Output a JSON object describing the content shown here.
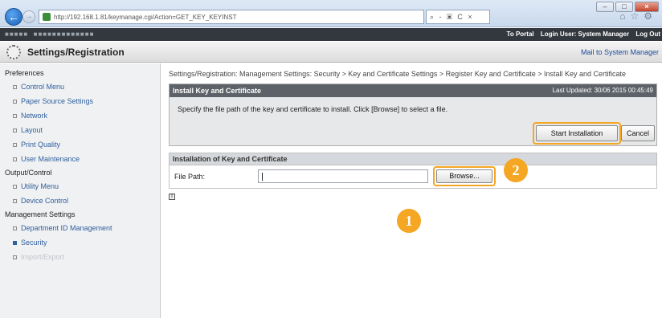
{
  "browser": {
    "address": "http://192.168.1.81/keymanage.cgi/Action=GET_KEY_KEYINST",
    "address_tools": "⌕ - ▣ C ×",
    "min_label": "–",
    "max_label": "□",
    "close_label": "×"
  },
  "user_bar": {
    "portal": "To Portal",
    "login_user": "Login User: System Manager",
    "logout": "Log Out"
  },
  "header": {
    "title": "Settings/Registration",
    "mail_link": "Mail to System Manager"
  },
  "sidebar": {
    "groups": [
      {
        "label": "Preferences",
        "items": [
          "Control Menu",
          "Paper Source Settings",
          "Network",
          "Layout",
          "Print Quality",
          "User Maintenance"
        ]
      },
      {
        "label": "Output/Control",
        "items": [
          "Utility Menu",
          "Device Control"
        ]
      },
      {
        "label": "Management Settings",
        "items": [
          "Department ID Management",
          "Security",
          "Import/Export"
        ]
      }
    ]
  },
  "main": {
    "breadcrumb": "Settings/Registration: Management Settings: Security > Key and Certificate Settings > Register Key and Certificate > Install Key and Certificate",
    "panel_title": "Install Key and Certificate",
    "last_updated": "Last Updated: 30/06 2015 00:45:49",
    "instruction": "Specify the file path of the key and certificate to install. Click [Browse] to select a file.",
    "start_button": "Start Installation",
    "cancel_button": "Cancel",
    "section_title": "Installation of Key and Certificate",
    "file_path_label": "File Path:",
    "file_path_value": "",
    "browse_button": "Browse..."
  },
  "markers": {
    "step1": "1",
    "step2": "2"
  },
  "colors": {
    "accent": "#f5a623",
    "panel_header": "#5d6268",
    "link": "#2f5f9e"
  }
}
